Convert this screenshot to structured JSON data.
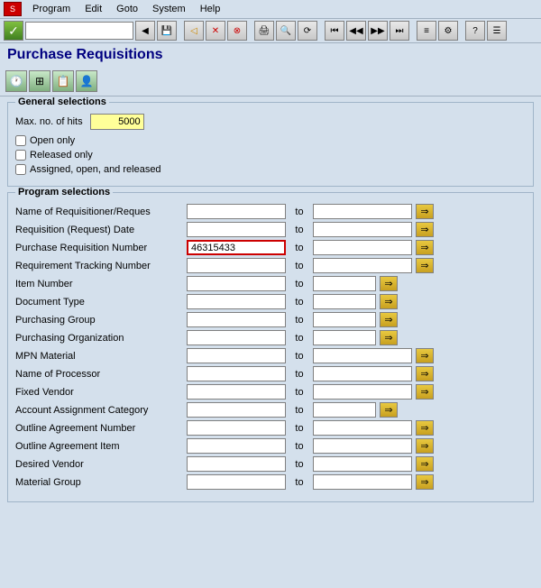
{
  "menubar": {
    "items": [
      "Program",
      "Edit",
      "Goto",
      "System",
      "Help"
    ]
  },
  "page": {
    "title": "Purchase Requisitions"
  },
  "action_buttons": [
    {
      "name": "clock-icon",
      "symbol": "🕐"
    },
    {
      "name": "table-icon",
      "symbol": "⊞"
    },
    {
      "name": "save-view-icon",
      "symbol": "💾"
    },
    {
      "name": "config-icon",
      "symbol": "⚙"
    }
  ],
  "general_selections": {
    "label": "General selections",
    "max_hits_label": "Max. no. of hits",
    "max_hits_value": "5000",
    "checkboxes": [
      {
        "label": "Open only",
        "checked": false
      },
      {
        "label": "Released only",
        "checked": false
      },
      {
        "label": "Assigned, open, and released",
        "checked": false
      }
    ]
  },
  "program_selections": {
    "label": "Program selections",
    "fields": [
      {
        "label": "Name of Requisitioner/Reques",
        "value": "",
        "to_value": "",
        "has_arrow": true,
        "small_right": false
      },
      {
        "label": "Requisition (Request) Date",
        "value": "",
        "to_value": "",
        "has_arrow": true,
        "small_right": false
      },
      {
        "label": "Purchase Requisition Number",
        "value": "46315433",
        "to_value": "",
        "has_arrow": true,
        "highlighted": true,
        "small_right": false
      },
      {
        "label": "Requirement Tracking Number",
        "value": "",
        "to_value": "",
        "has_arrow": true,
        "small_right": false
      },
      {
        "label": "Item Number",
        "value": "",
        "to_value": "",
        "has_arrow": true,
        "small_right": true
      },
      {
        "label": "Document Type",
        "value": "",
        "to_value": "",
        "has_arrow": true,
        "small_right": true
      },
      {
        "label": "Purchasing Group",
        "value": "",
        "to_value": "",
        "has_arrow": true,
        "small_right": true
      },
      {
        "label": "Purchasing Organization",
        "value": "",
        "to_value": "",
        "has_arrow": true,
        "small_right": true
      },
      {
        "label": "MPN Material",
        "value": "",
        "to_value": "",
        "has_arrow": true,
        "small_right": false
      },
      {
        "label": "Name of Processor",
        "value": "",
        "to_value": "",
        "has_arrow": true,
        "small_right": false
      },
      {
        "label": "Fixed Vendor",
        "value": "",
        "to_value": "",
        "has_arrow": true,
        "small_right": false
      },
      {
        "label": "Account Assignment Category",
        "value": "",
        "to_value": "",
        "has_arrow": true,
        "small_right": true
      },
      {
        "label": "Outline Agreement Number",
        "value": "",
        "to_value": "",
        "has_arrow": true,
        "small_right": false
      },
      {
        "label": "Outline Agreement Item",
        "value": "",
        "to_value": "",
        "has_arrow": true,
        "small_right": false
      },
      {
        "label": "Desired Vendor",
        "value": "",
        "to_value": "",
        "has_arrow": true,
        "small_right": false
      },
      {
        "label": "Material Group",
        "value": "",
        "to_value": "",
        "has_arrow": true,
        "small_right": false
      }
    ]
  }
}
